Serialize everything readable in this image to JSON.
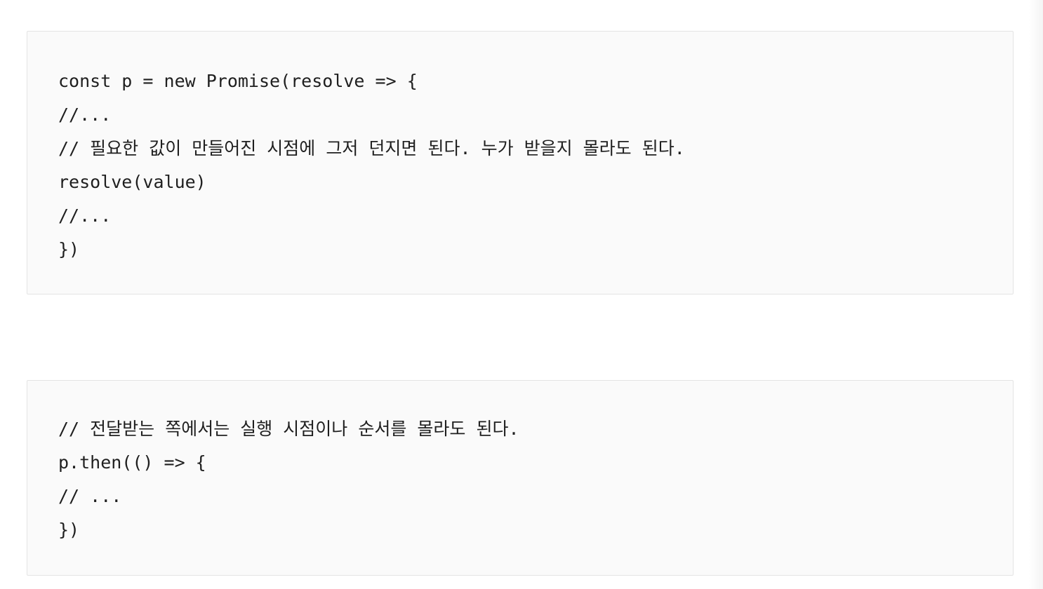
{
  "code_blocks": [
    {
      "lines": [
        "const p = new Promise(resolve => {",
        "//...",
        "// 필요한 값이 만들어진 시점에 그저 던지면 된다. 누가 받을지 몰라도 된다.",
        "resolve(value)",
        "//...",
        "})"
      ]
    },
    {
      "lines": [
        "// 전달받는 쪽에서는 실행 시점이나 순서를 몰라도 된다.",
        "p.then(() => {",
        "// ...",
        "})"
      ]
    }
  ]
}
